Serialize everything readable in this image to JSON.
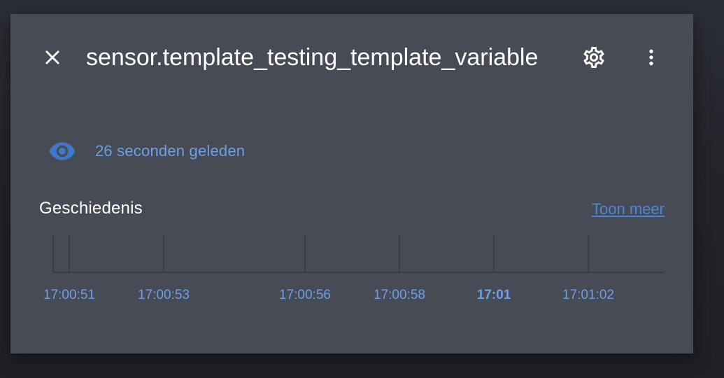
{
  "dialog": {
    "title": "sensor.template_testing_template_variable",
    "close_icon": "close-icon",
    "settings_icon": "gear-icon",
    "more_icon": "dots-vertical-icon"
  },
  "last_changed": {
    "icon": "eye-icon",
    "text": "26 seconden geleden"
  },
  "history": {
    "title": "Geschiedenis",
    "show_more": "Toon meer",
    "ticks": [
      {
        "label": "17:00:51",
        "bold": false
      },
      {
        "label": "17:00:53",
        "bold": false
      },
      {
        "label": "17:00:56",
        "bold": false
      },
      {
        "label": "17:00:58",
        "bold": false
      },
      {
        "label": "17:01",
        "bold": true
      },
      {
        "label": "17:01:02",
        "bold": false
      }
    ]
  },
  "colors": {
    "dialog_bg": "#474b55",
    "accent": "#4d86d8",
    "accent_text": "#6f9fe3",
    "eye_icon": "#3f78c9"
  }
}
